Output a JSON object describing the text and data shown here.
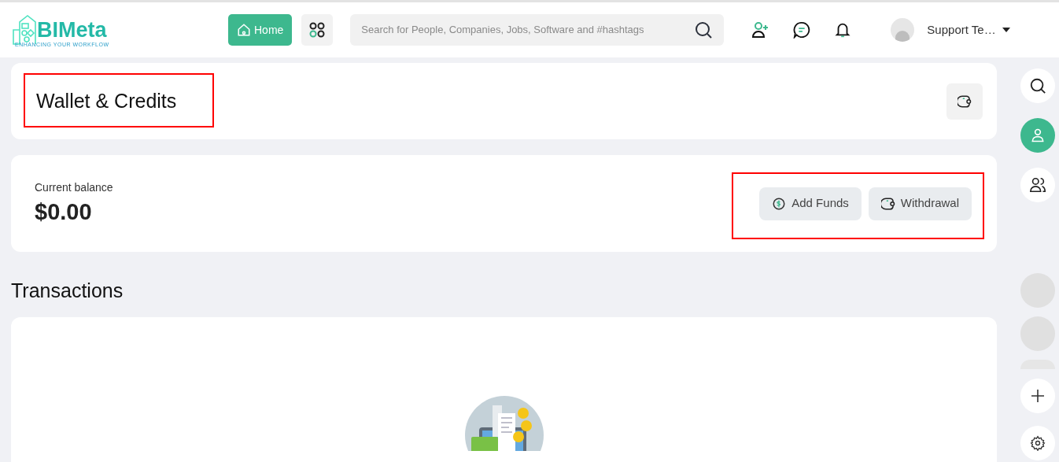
{
  "logo": {
    "name": "BIMeta",
    "tagline": "ENHANCING YOUR WORKFLOW"
  },
  "nav": {
    "home": "Home",
    "search": {
      "placeholder": "Search for People, Companies, Jobs, Software and #hashtags"
    },
    "user": "Support Te…"
  },
  "header": {
    "title": "Wallet & Credits"
  },
  "balance": {
    "label": "Current balance",
    "amount": "$0.00",
    "actions": [
      "Add Funds",
      "Withdrawal"
    ]
  },
  "transactions": {
    "title": "Transactions"
  },
  "rail": [
    {
      "kind": "search",
      "selected": false
    },
    {
      "kind": "profile",
      "selected": true
    },
    {
      "kind": "people",
      "selected": false
    }
  ]
}
